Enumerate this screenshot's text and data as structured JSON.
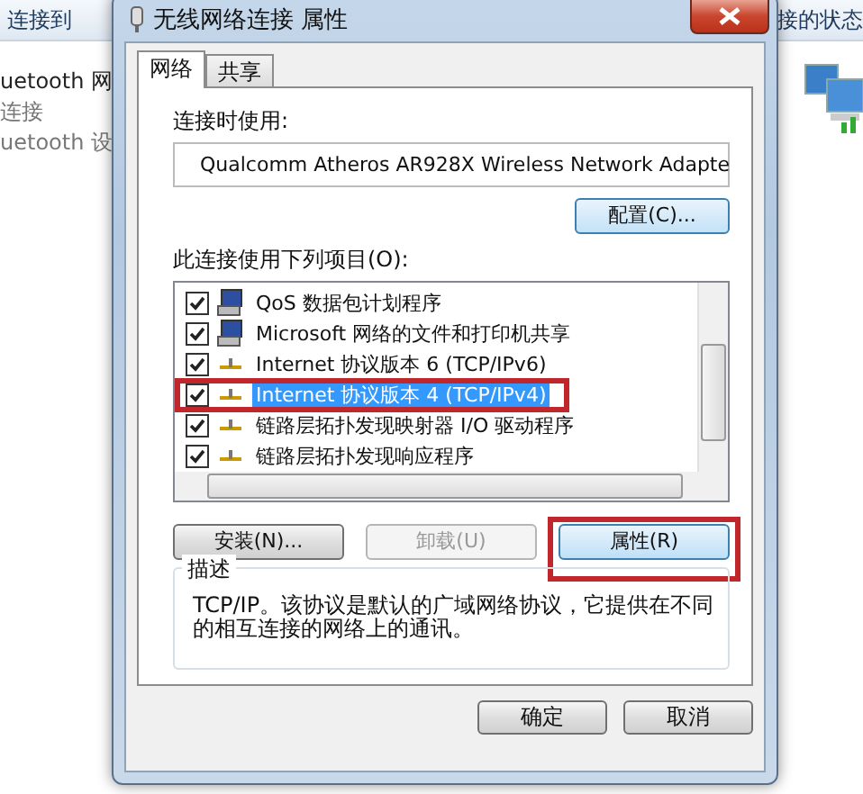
{
  "background_window": {
    "header_left": "连接到",
    "header_right": "接的状态",
    "connection": {
      "name": "uetooth 网",
      "status": "连接",
      "device": "uetooth 设"
    }
  },
  "dialog": {
    "title": "无线网络连接 属性",
    "tabs": [
      {
        "label": "网络",
        "selected": true
      },
      {
        "label": "共享",
        "selected": false
      }
    ],
    "connect_using_label": "连接时使用:",
    "adapter": "Qualcomm Atheros AR928X Wireless Network Adapte",
    "configure_button": "配置(C)...",
    "items_label": "此连接使用下列项目(O):",
    "items": [
      {
        "kind": "client",
        "label": "QoS 数据包计划程序",
        "checked": true,
        "selected": false,
        "highlighted": false
      },
      {
        "kind": "client",
        "label": "Microsoft 网络的文件和打印机共享",
        "checked": true,
        "selected": false,
        "highlighted": false
      },
      {
        "kind": "protocol",
        "label": "Internet 协议版本 6 (TCP/IPv6)",
        "checked": true,
        "selected": false,
        "highlighted": false
      },
      {
        "kind": "protocol",
        "label": "Internet 协议版本 4 (TCP/IPv4)",
        "checked": true,
        "selected": true,
        "highlighted": true
      },
      {
        "kind": "protocol",
        "label": "链路层拓扑发现映射器 I/O 驱动程序",
        "checked": true,
        "selected": false,
        "highlighted": false
      },
      {
        "kind": "protocol",
        "label": "链路层拓扑发现响应程序",
        "checked": true,
        "selected": false,
        "highlighted": false
      }
    ],
    "buttons": [
      {
        "label": "安装(N)...",
        "disabled": false,
        "highlighted": false
      },
      {
        "label": "卸载(U)",
        "disabled": true,
        "highlighted": false
      },
      {
        "label": "属性(R)",
        "disabled": false,
        "highlighted": true
      }
    ],
    "description": {
      "title": "描述",
      "text": "TCP/IP。该协议是默认的广域网络协议，它提供在不同的相互连接的网络上的通讯。"
    },
    "footer_buttons": [
      "确定",
      "取消"
    ]
  }
}
